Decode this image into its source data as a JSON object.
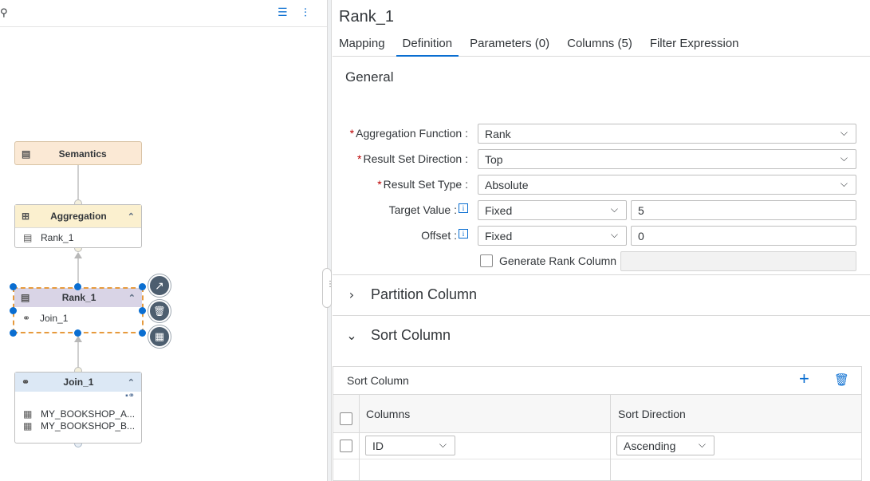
{
  "canvas": {
    "nodes": {
      "semantics": {
        "title": "Semantics"
      },
      "aggregation": {
        "title": "Aggregation",
        "rows": [
          "Rank_1"
        ]
      },
      "rank": {
        "title": "Rank_1",
        "rows": [
          "Join_1"
        ]
      },
      "join": {
        "title": "Join_1",
        "rows": [
          "MY_BOOKSHOP_A...",
          "MY_BOOKSHOP_B..."
        ]
      }
    }
  },
  "details": {
    "title": "Rank_1",
    "tabs": [
      "Mapping",
      "Definition",
      "Parameters (0)",
      "Columns (5)",
      "Filter Expression"
    ],
    "active_tab": "Definition",
    "general": {
      "title": "General",
      "aggregation_function": {
        "label": "Aggregation Function :",
        "value": "Rank"
      },
      "result_set_direction": {
        "label": "Result Set Direction :",
        "value": "Top"
      },
      "result_set_type": {
        "label": "Result Set Type :",
        "value": "Absolute"
      },
      "target_value": {
        "label": "Target Value :",
        "mode": "Fixed",
        "value": "5"
      },
      "offset": {
        "label": "Offset :",
        "mode": "Fixed",
        "value": "0"
      },
      "generate_rank_column": {
        "label": "Generate Rank Column :",
        "checked": false,
        "value": ""
      }
    },
    "partition_column": {
      "title": "Partition Column"
    },
    "sort_column": {
      "title": "Sort Column",
      "table_title": "Sort Column",
      "headers": [
        "Columns",
        "Sort Direction"
      ],
      "rows": [
        {
          "column": "ID",
          "direction": "Ascending"
        }
      ]
    }
  },
  "colors": {
    "accent": "#0a6ed1",
    "required": "#bb0000",
    "selection": "#e69a3d"
  }
}
